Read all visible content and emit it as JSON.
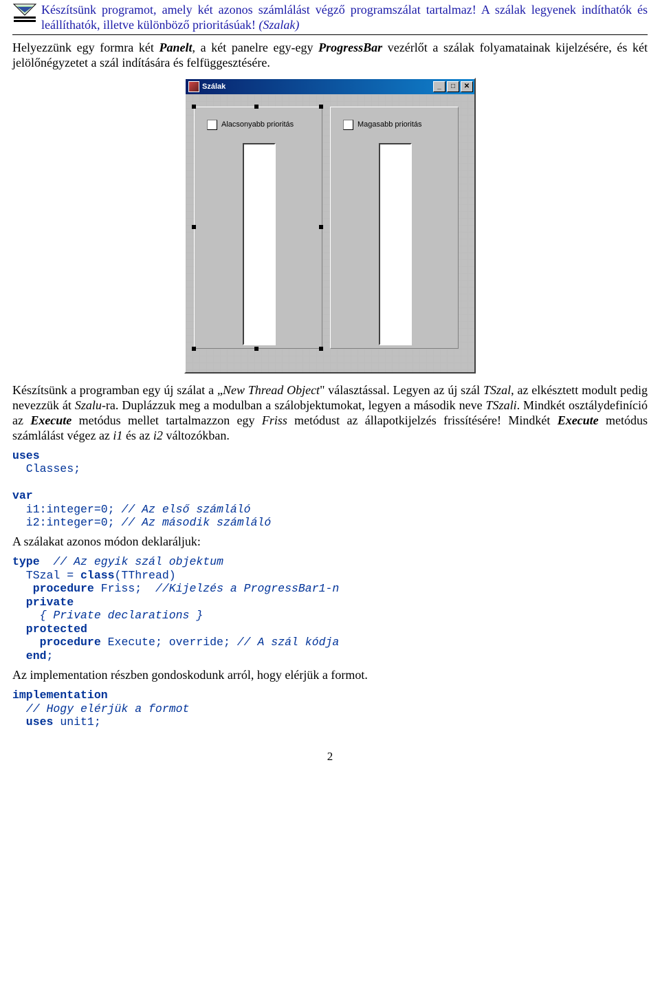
{
  "header": {
    "title_part1": "Készítsünk programot, amely két azonos számlálást végző programszálat tartalmaz! A szálak legyenek indíthatók és leállíthatók, illetve különböző prioritásúak! ",
    "title_tag": "(Szalak)"
  },
  "para1": {
    "a": "Helyezzünk egy formra két ",
    "b": "Panelt",
    "c": ", a két panelre egy-egy ",
    "d": "ProgressBar",
    "e": " vezérlőt a szálak folyamatainak kijelzésére, és két jelölőnégyzetet a szál indítására és felfüggesztésére."
  },
  "window": {
    "title": "Szálak",
    "checkbox_left": "Alacsonyabb prioritás",
    "checkbox_right": "Magasabb prioritás",
    "min": "_",
    "max": "□",
    "close": "✕"
  },
  "para2": {
    "a": "Készítsünk a programban egy új szálat a „",
    "b": "New Thread Object",
    "c": "\" választással. Legyen az új szál ",
    "d": "TSzal",
    "e": ", az elkésztett modult pedig nevezzük át ",
    "f": "Szalu",
    "g": "-ra. Duplázzuk meg a modulban a szálobjektumokat, legyen a második neve ",
    "h": "TSzali",
    "i": ". Mindkét osztálydefiníció az ",
    "j": "Execute",
    "k": " metódus mellet tartalmazzon egy ",
    "l": "Friss",
    "m": " metódust az állapotkijelzés frissítésére! Mindkét ",
    "n": "Execute",
    "o": " metódus számlálást végez az ",
    "p": "i1",
    "q": " és az ",
    "r": "i2",
    "s": " változókban."
  },
  "code1": {
    "uses": "uses",
    "classes": "  Classes;",
    "var": "var",
    "i1a": "  i1:integer=0; ",
    "i1b": "// Az első számláló",
    "i2a": "  i2:integer=0; ",
    "i2b": "// Az második számláló"
  },
  "para3": "A szálakat azonos módon deklaráljuk:",
  "code2": {
    "l1a": "type  ",
    "l1b": "// Az egyik szál objektum",
    "l2": "  TSzal = ",
    "l2b": "class",
    "l2c": "(TThread)",
    "l3a": "   procedure",
    "l3b": " Friss;  ",
    "l3c": "//Kijelzés a ProgressBar1-n",
    "l4": "  private",
    "l5": "    { Private declarations }",
    "l6": "  protected",
    "l7a": "    procedure",
    "l7b": " Execute; override; ",
    "l7c": "// A szál kódja",
    "l8": "  end",
    "l8b": ";"
  },
  "para4": "Az implementation részben gondoskodunk arról, hogy elérjük a formot.",
  "code3": {
    "l1": "implementation",
    "l2": "  // Hogy elérjük a formot",
    "l3a": "  uses",
    "l3b": " unit1;"
  },
  "pagenum": "2"
}
